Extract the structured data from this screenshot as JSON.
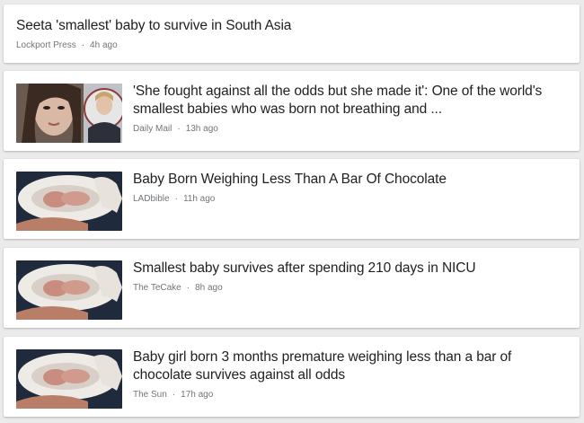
{
  "articles": [
    {
      "headline": "Seeta 'smallest' baby to survive in South Asia",
      "source": "Lockport Press",
      "age": "4h ago",
      "has_thumbnail": false
    },
    {
      "headline": "'She fought against all the odds but she made it': One of the world's smallest babies who was born not breathing and ...",
      "source": "Daily Mail",
      "age": "13h ago",
      "has_thumbnail": true
    },
    {
      "headline": "Baby Born Weighing Less Than A Bar Of Chocolate",
      "source": "LADbible",
      "age": "11h ago",
      "has_thumbnail": true
    },
    {
      "headline": "Smallest baby survives after spending 210 days in NICU",
      "source": "The TeCake",
      "age": "8h ago",
      "has_thumbnail": true
    },
    {
      "headline": "Baby girl born 3 months premature weighing less than a bar of chocolate survives against all odds",
      "source": "The Sun",
      "age": "17h ago",
      "has_thumbnail": true
    }
  ],
  "separator": "·"
}
